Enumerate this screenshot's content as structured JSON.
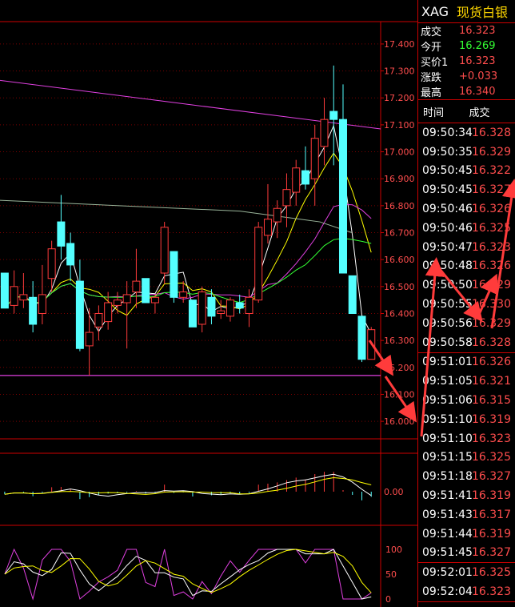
{
  "quote": {
    "code": "XAG",
    "name": "现货白银",
    "fields": [
      {
        "label": "成交",
        "value": "16.323",
        "color": "red"
      },
      {
        "label": "今开",
        "value": "16.269",
        "color": "green"
      },
      {
        "label": "买价1",
        "value": "16.323",
        "color": "red"
      },
      {
        "label": "涨跌",
        "value": "+0.033",
        "color": "red"
      },
      {
        "label": "最高",
        "value": "16.340",
        "color": "red"
      }
    ]
  },
  "ticks_header": {
    "time": "时间",
    "price": "成交"
  },
  "tick_groups": [
    [
      {
        "time": "09:50:34",
        "price": "16.328"
      },
      {
        "time": "09:50:35",
        "price": "16.329"
      },
      {
        "time": "09:50:45",
        "price": "16.322"
      },
      {
        "time": "09:50:45",
        "price": "16.327"
      },
      {
        "time": "09:50:46",
        "price": "16.326"
      },
      {
        "time": "09:50:46",
        "price": "16.325"
      },
      {
        "time": "09:50:47",
        "price": "16.323"
      },
      {
        "time": "09:50:48",
        "price": "16.326"
      },
      {
        "time": "09:50:50",
        "price": "16.329"
      },
      {
        "time": "09:50:55",
        "price": "16.330"
      },
      {
        "time": "09:50:56",
        "price": "16.329"
      },
      {
        "time": "09:50:58",
        "price": "16.328"
      }
    ],
    [
      {
        "time": "09:51:01",
        "price": "16.326"
      },
      {
        "time": "09:51:05",
        "price": "16.321"
      },
      {
        "time": "09:51:06",
        "price": "16.315"
      },
      {
        "time": "09:51:10",
        "price": "16.319"
      },
      {
        "time": "09:51:10",
        "price": "16.323"
      },
      {
        "time": "09:51:15",
        "price": "16.325"
      },
      {
        "time": "09:51:18",
        "price": "16.327"
      },
      {
        "time": "09:51:41",
        "price": "16.319"
      },
      {
        "time": "09:51:43",
        "price": "16.317"
      },
      {
        "time": "09:51:44",
        "price": "16.319"
      },
      {
        "time": "09:51:45",
        "price": "16.327"
      }
    ],
    [
      {
        "time": "09:52:01",
        "price": "16.325"
      },
      {
        "time": "09:52:04",
        "price": "16.323"
      }
    ]
  ],
  "chart_data": {
    "type": "candlestick",
    "y_axis": {
      "ticks": [
        "17.400",
        "17.300",
        "17.200",
        "17.100",
        "17.000",
        "16.900",
        "16.800",
        "16.700",
        "16.600",
        "16.500",
        "16.400",
        "16.300",
        "16.200",
        "16.100",
        "16.000"
      ],
      "ylim": [
        15.935,
        17.48
      ]
    },
    "candles": [
      [
        16.55,
        16.55,
        16.42,
        16.42
      ],
      [
        16.43,
        16.56,
        16.4,
        16.5
      ],
      [
        16.45,
        16.55,
        16.42,
        16.47
      ],
      [
        16.46,
        16.52,
        16.33,
        16.36
      ],
      [
        16.4,
        16.58,
        16.36,
        16.47
      ],
      [
        16.53,
        16.67,
        16.48,
        16.64
      ],
      [
        16.74,
        16.84,
        16.6,
        16.65
      ],
      [
        16.66,
        16.7,
        16.52,
        16.58
      ],
      [
        16.52,
        16.6,
        16.26,
        16.27
      ],
      [
        16.28,
        16.42,
        16.17,
        16.33
      ],
      [
        16.35,
        16.43,
        16.3,
        16.4
      ],
      [
        16.37,
        16.48,
        16.34,
        16.44
      ],
      [
        16.43,
        16.48,
        16.4,
        16.45
      ],
      [
        16.44,
        16.52,
        16.27,
        16.47
      ],
      [
        16.48,
        16.64,
        16.42,
        16.52
      ],
      [
        16.53,
        16.53,
        16.44,
        16.44
      ],
      [
        16.44,
        16.47,
        16.4,
        16.46
      ],
      [
        16.55,
        16.74,
        16.51,
        16.72
      ],
      [
        16.63,
        16.63,
        16.44,
        16.46
      ],
      [
        16.46,
        16.52,
        16.44,
        16.48
      ],
      [
        16.45,
        16.45,
        16.35,
        16.35
      ],
      [
        16.36,
        16.5,
        16.33,
        16.48
      ],
      [
        16.46,
        16.49,
        16.36,
        16.39
      ],
      [
        16.4,
        16.45,
        16.38,
        16.41
      ],
      [
        16.39,
        16.46,
        16.37,
        16.45
      ],
      [
        16.44,
        16.47,
        16.4,
        16.42
      ],
      [
        16.4,
        16.49,
        16.35,
        16.46
      ],
      [
        16.45,
        16.74,
        16.44,
        16.72
      ],
      [
        16.69,
        16.88,
        16.66,
        16.75
      ],
      [
        16.74,
        16.82,
        16.68,
        16.79
      ],
      [
        16.8,
        16.92,
        16.72,
        16.86
      ],
      [
        16.85,
        16.97,
        16.8,
        16.94
      ],
      [
        16.93,
        17.02,
        16.86,
        16.88
      ],
      [
        16.9,
        17.1,
        16.8,
        17.05
      ],
      [
        17.02,
        17.2,
        16.95,
        17.12
      ],
      [
        17.15,
        17.32,
        16.95,
        17.12
      ],
      [
        17.12,
        17.25,
        16.55,
        16.55
      ],
      [
        16.54,
        16.54,
        16.4,
        16.4
      ],
      [
        16.39,
        16.39,
        16.22,
        16.23
      ],
      [
        16.23,
        16.35,
        16.28,
        16.34
      ]
    ],
    "horizontal_line": 16.17,
    "macd_ticks": [
      "0.00"
    ],
    "kdj_ticks": [
      "100",
      "50",
      "0"
    ]
  }
}
